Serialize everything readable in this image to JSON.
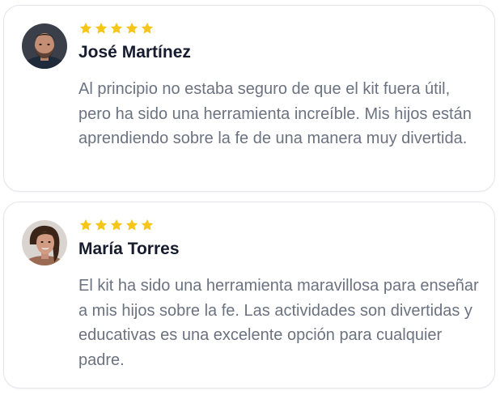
{
  "colors": {
    "star": "#f5c518",
    "name": "#161b2e",
    "body_text": "#6b7280",
    "card_border": "#e3e5ea"
  },
  "reviews": [
    {
      "avatar_icon": "man-avatar-photo",
      "rating": 5,
      "name": "José Martínez",
      "text": "Al principio no estaba seguro de que el kit fuera útil, pero ha sido una herramienta increíble. Mis hijos están aprendiendo sobre la fe de una manera muy divertida."
    },
    {
      "avatar_icon": "woman-avatar-photo",
      "rating": 5,
      "name": "María Torres",
      "text": "El kit ha sido una herramienta maravillosa para enseñar a mis hijos sobre la fe. Las actividades son divertidas y educativas es una excelente opción para cualquier padre."
    }
  ]
}
